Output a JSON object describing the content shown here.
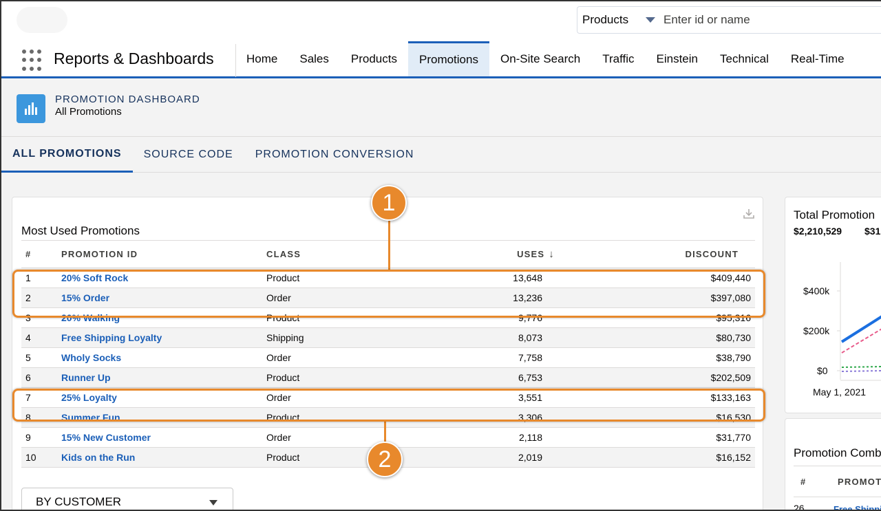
{
  "global_search": {
    "scope_label": "Products",
    "placeholder": "Enter id or name"
  },
  "app": {
    "name": "Reports & Dashboards"
  },
  "nav": {
    "items": [
      {
        "label": "Home"
      },
      {
        "label": "Sales"
      },
      {
        "label": "Products"
      },
      {
        "label": "Promotions",
        "active": true
      },
      {
        "label": "On-Site Search"
      },
      {
        "label": "Traffic"
      },
      {
        "label": "Einstein"
      },
      {
        "label": "Technical"
      },
      {
        "label": "Real-Time"
      }
    ]
  },
  "page_header": {
    "eyebrow": "PROMOTION DASHBOARD",
    "title": "All Promotions",
    "icon": "dashboard-icon"
  },
  "tabs": [
    {
      "label": "ALL PROMOTIONS",
      "active": true
    },
    {
      "label": "SOURCE CODE"
    },
    {
      "label": "PROMOTION CONVERSION"
    }
  ],
  "most_used": {
    "title": "Most Used Promotions",
    "download_icon": "download-icon",
    "columns": {
      "num": "#",
      "promotion_id": "PROMOTION ID",
      "class": "CLASS",
      "uses": "USES",
      "uses_sort": "↓",
      "discount": "DISCOUNT"
    },
    "rows": [
      {
        "num": "1",
        "promotion_id": "20% Soft Rock",
        "class": "Product",
        "uses": "13,648",
        "discount": "$409,440"
      },
      {
        "num": "2",
        "promotion_id": "15% Order",
        "class": "Order",
        "uses": "13,236",
        "discount": "$397,080"
      },
      {
        "num": "3",
        "promotion_id": "20% Walking",
        "class": "Product",
        "uses": "9,776",
        "discount": "$95,316"
      },
      {
        "num": "4",
        "promotion_id": "Free Shipping Loyalty",
        "class": "Shipping",
        "uses": "8,073",
        "discount": "$80,730"
      },
      {
        "num": "5",
        "promotion_id": "Wholy Socks",
        "class": "Order",
        "uses": "7,758",
        "discount": "$38,790"
      },
      {
        "num": "6",
        "promotion_id": "Runner Up",
        "class": "Product",
        "uses": "6,753",
        "discount": "$202,509"
      },
      {
        "num": "7",
        "promotion_id": "25% Loyalty",
        "class": "Order",
        "uses": "3,551",
        "discount": "$133,163"
      },
      {
        "num": "8",
        "promotion_id": "Summer Fun",
        "class": "Product",
        "uses": "3,306",
        "discount": "$16,530"
      },
      {
        "num": "9",
        "promotion_id": "15% New Customer",
        "class": "Order",
        "uses": "2,118",
        "discount": "$31,770"
      },
      {
        "num": "10",
        "promotion_id": "Kids on the Run",
        "class": "Product",
        "uses": "2,019",
        "discount": "$16,152"
      }
    ],
    "dropdown": {
      "value": "BY CUSTOMER"
    }
  },
  "total_promotion": {
    "title": "Total Promotion",
    "value_1": "$2,210,529",
    "value_2": "$31",
    "y_ticks": [
      "$400k",
      "$200k",
      "$0"
    ],
    "x_tick": "May 1, 2021"
  },
  "promotion_combo": {
    "title": "Promotion Comb",
    "columns": {
      "num": "#",
      "promotion": "PROMOT"
    },
    "row_num": "26",
    "row_link": "Free Shipping"
  },
  "callouts": [
    {
      "label": "1"
    },
    {
      "label": "2"
    }
  ],
  "colors": {
    "accent": "#1b5fb8",
    "callout": "#e8892c",
    "link": "#1b5fb8",
    "icon_blue": "#3c97dd"
  }
}
